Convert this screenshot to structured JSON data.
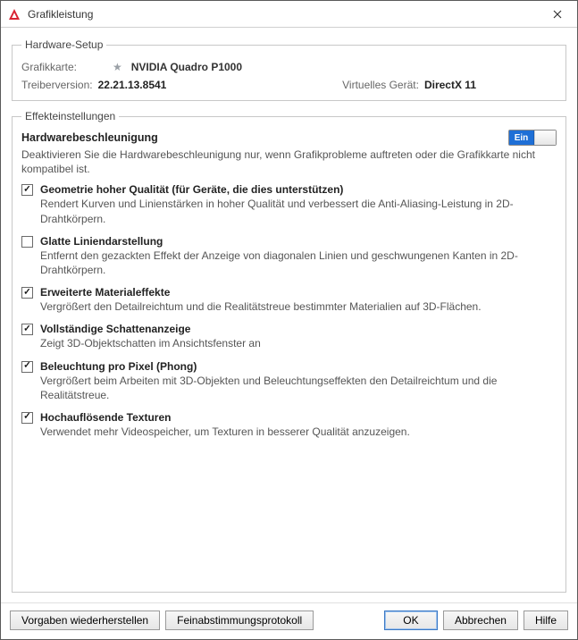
{
  "titlebar": {
    "title": "Grafikleistung"
  },
  "hardware": {
    "legend": "Hardware-Setup",
    "card_label": "Grafikkarte:",
    "card_value": "NVIDIA Quadro P1000",
    "driver_label": "Treiberversion:",
    "driver_value": "22.21.13.8541",
    "virtual_label": "Virtuelles Gerät:",
    "virtual_value": "DirectX 11"
  },
  "effects": {
    "legend": "Effekteinstellungen",
    "hwaccel_title": "Hardwarebeschleunigung",
    "toggle_on_label": "Ein",
    "hwaccel_desc": "Deaktivieren Sie die Hardwarebeschleunigung nur, wenn Grafikprobleme auftreten oder die Grafikkarte nicht kompatibel ist.",
    "options": [
      {
        "checked": true,
        "title": "Geometrie hoher Qualität (für Geräte, die dies unterstützen)",
        "desc": "Rendert Kurven und Linienstärken in hoher Qualität und verbessert die Anti-Aliasing-Leistung in 2D-Drahtkörpern."
      },
      {
        "checked": false,
        "title": "Glatte Liniendarstellung",
        "desc": "Entfernt den gezackten Effekt der Anzeige von diagonalen Linien und geschwungenen Kanten in 2D-Drahtkörpern."
      },
      {
        "checked": true,
        "title": "Erweiterte Materialeffekte",
        "desc": "Vergrößert den Detailreichtum und die Realitätstreue bestimmter Materialien auf 3D-Flächen."
      },
      {
        "checked": true,
        "title": "Vollständige Schattenanzeige",
        "desc": "Zeigt 3D-Objektschatten im Ansichtsfenster an"
      },
      {
        "checked": true,
        "title": "Beleuchtung pro Pixel (Phong)",
        "desc": "Vergrößert beim Arbeiten mit 3D-Objekten und Beleuchtungseffekten den Detailreichtum und die Realitätstreue."
      },
      {
        "checked": true,
        "title": "Hochauflösende Texturen",
        "desc": "Verwendet mehr Videospeicher, um Texturen in besserer Qualität anzuzeigen."
      }
    ]
  },
  "buttons": {
    "restore": "Vorgaben wiederherstellen",
    "tuner": "Feinabstimmungsprotokoll",
    "ok": "OK",
    "cancel": "Abbrechen",
    "help": "Hilfe"
  }
}
